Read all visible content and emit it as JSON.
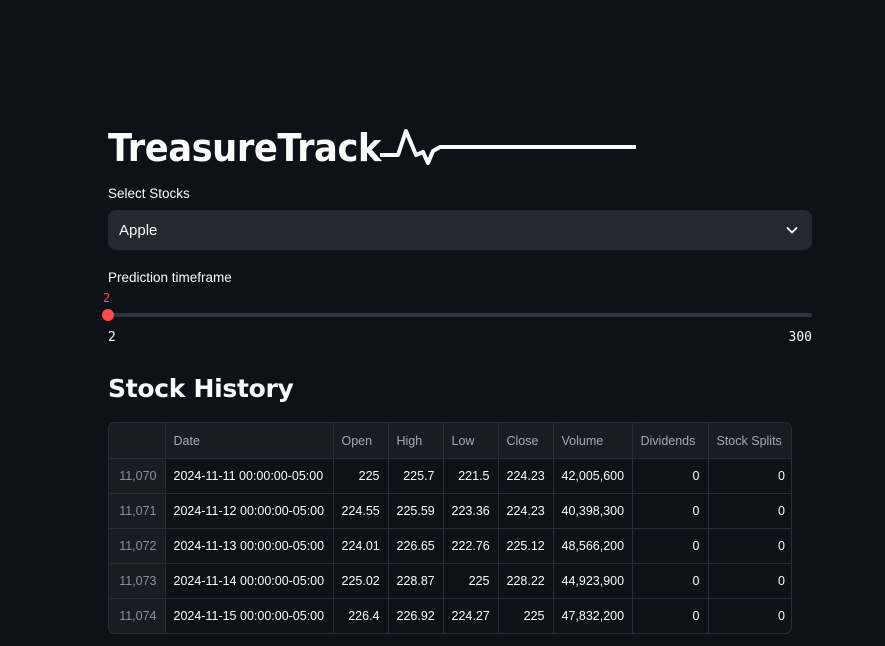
{
  "app": {
    "title": "TreasureTrack"
  },
  "stock_select": {
    "label": "Select Stocks",
    "value": "Apple"
  },
  "timeframe": {
    "label": "Prediction timeframe",
    "value": "2",
    "min": "2",
    "max": "300",
    "fraction": 0.0
  },
  "history": {
    "title": "Stock History",
    "columns": [
      "",
      "Date",
      "Open",
      "High",
      "Low",
      "Close",
      "Volume",
      "Dividends",
      "Stock Splits"
    ],
    "rows": [
      [
        "11,070",
        "2024-11-11 00:00:00-05:00",
        "225",
        "225.7",
        "221.5",
        "224.23",
        "42,005,600",
        "0",
        "0"
      ],
      [
        "11,071",
        "2024-11-12 00:00:00-05:00",
        "224.55",
        "225.59",
        "223.36",
        "224.23",
        "40,398,300",
        "0",
        "0"
      ],
      [
        "11,072",
        "2024-11-13 00:00:00-05:00",
        "224.01",
        "226.65",
        "222.76",
        "225.12",
        "48,566,200",
        "0",
        "0"
      ],
      [
        "11,073",
        "2024-11-14 00:00:00-05:00",
        "225.02",
        "228.87",
        "225",
        "228.22",
        "44,923,900",
        "0",
        "0"
      ],
      [
        "11,074",
        "2024-11-15 00:00:00-05:00",
        "226.4",
        "226.92",
        "224.27",
        "225",
        "47,832,200",
        "0",
        "0"
      ]
    ]
  },
  "colors": {
    "background": "#0e1117",
    "accent": "#ff4b4b",
    "input_bg": "#262730"
  },
  "icons": {
    "select_chevron": "chevron-down-icon",
    "title_decoration": "pulse-line-icon"
  }
}
